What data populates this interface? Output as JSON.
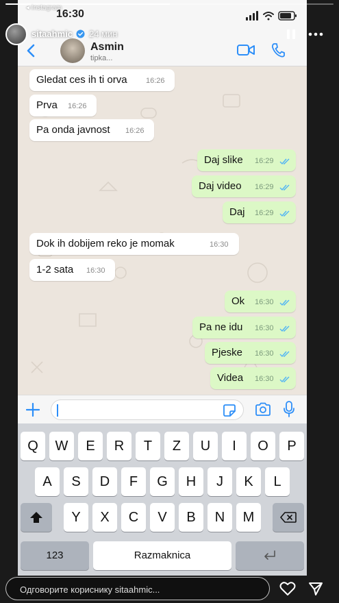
{
  "story": {
    "source": "◂ Instagram",
    "username": "sitaahmic",
    "posted": "24 мин",
    "reply_placeholder": "Одговорите кориснику sitaahmic...",
    "progress": 0.5,
    "icons": {
      "pause": "pause-icon",
      "more": "more-icon",
      "like": "heart-icon",
      "send": "send-icon",
      "verified": "verified-badge-icon"
    }
  },
  "whatsapp": {
    "status_time": "16:30",
    "contact": {
      "name": "Asmin",
      "status": "tipka..."
    },
    "accent_color": "#2c8ef8",
    "messages": [
      {
        "dir": "in",
        "text": "Gledat ces ih ti orva",
        "time": "16:26"
      },
      {
        "dir": "in",
        "text": "Prva",
        "time": "16:26"
      },
      {
        "dir": "in",
        "text": "Pa onda javnost",
        "time": "16:26"
      },
      {
        "dir": "out",
        "text": "Daj slike",
        "time": "16:29"
      },
      {
        "dir": "out",
        "text": "Daj video",
        "time": "16:29"
      },
      {
        "dir": "out",
        "text": "Daj",
        "time": "16:29"
      },
      {
        "dir": "in",
        "text": "Dok ih dobijem reko je momak",
        "time": "16:30"
      },
      {
        "dir": "in",
        "text": "1-2 sata",
        "time": "16:30"
      },
      {
        "dir": "out",
        "text": "Ok",
        "time": "16:30"
      },
      {
        "dir": "out",
        "text": "Pa ne idu",
        "time": "16:30"
      },
      {
        "dir": "out",
        "text": "Pjeske",
        "time": "16:30"
      },
      {
        "dir": "out",
        "text": "Videa",
        "time": "16:30"
      }
    ],
    "input": {
      "value": "",
      "placeholder": ""
    }
  },
  "keyboard": {
    "row1": [
      "Q",
      "W",
      "E",
      "R",
      "T",
      "Z",
      "U",
      "I",
      "O",
      "P"
    ],
    "row2": [
      "A",
      "S",
      "D",
      "F",
      "G",
      "H",
      "J",
      "K",
      "L"
    ],
    "row3": [
      "Y",
      "X",
      "C",
      "V",
      "B",
      "N",
      "M"
    ],
    "numbers": "123",
    "space": "Razmaknica"
  }
}
